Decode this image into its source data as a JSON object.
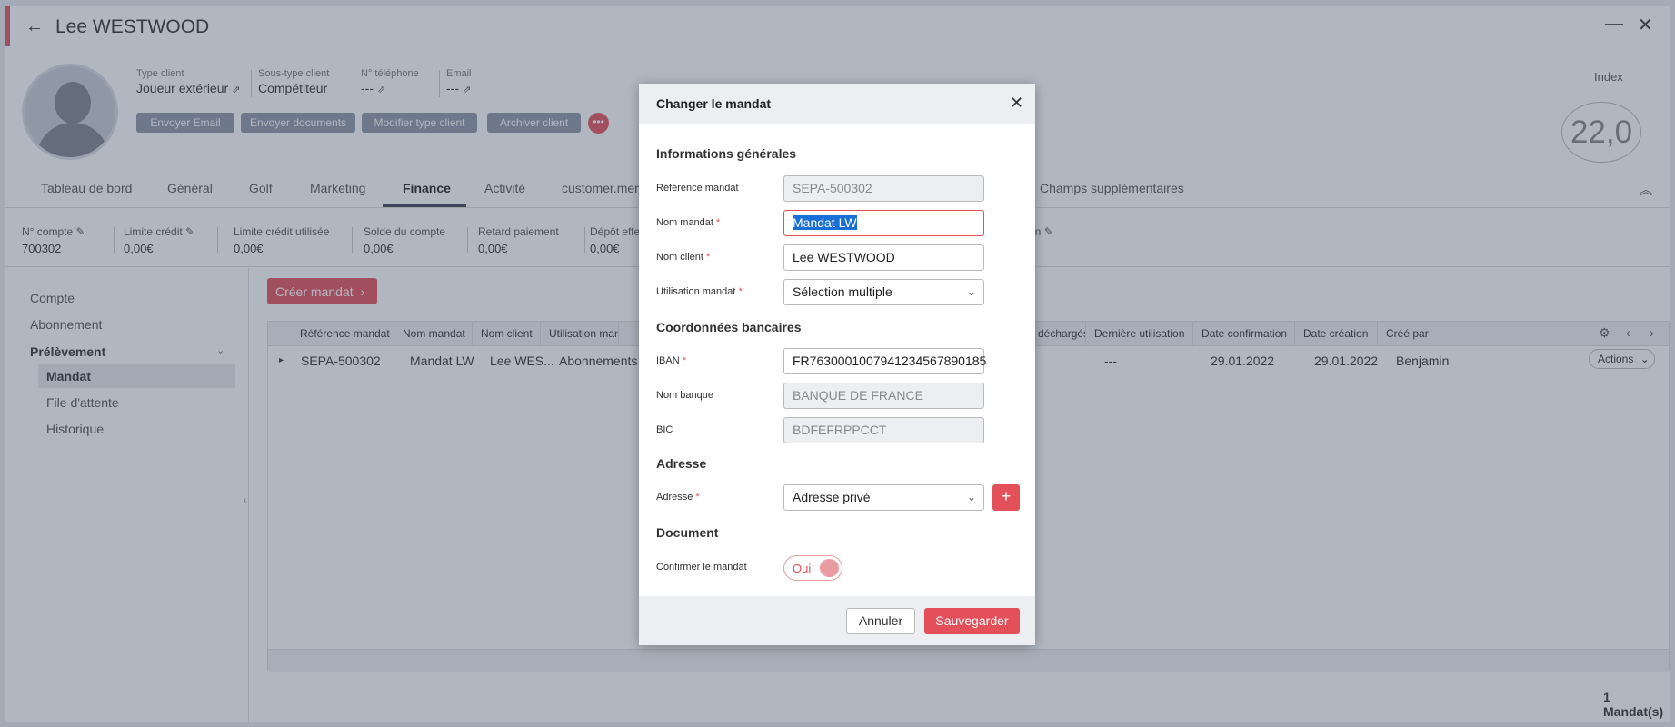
{
  "header": {
    "client_name": "Lee WESTWOOD",
    "back_icon": "←",
    "minimize_icon": "—",
    "close_icon": "✕",
    "index_label": "Index",
    "index_value": "22,0"
  },
  "client_info": [
    {
      "label": "Type client",
      "value": "Joueur extérieur",
      "ext": "⇗"
    },
    {
      "label": "Sous-type client",
      "value": "Compétiteur",
      "ext": ""
    },
    {
      "label": "N° téléphone",
      "value": "---",
      "ext": "⇗"
    },
    {
      "label": "Email",
      "value": "---",
      "ext": "⇗"
    }
  ],
  "actions": [
    "Envoyer Email",
    "Envoyer documents",
    "Modifier type client",
    "Archiver client"
  ],
  "more_icon": "•••",
  "tabs": [
    "Tableau de bord",
    "Général",
    "Golf",
    "Marketing",
    "Finance",
    "Activité",
    "customer.menu",
    "Champs supplémentaires"
  ],
  "collapse_icon": "︽",
  "stats": [
    {
      "label": "N° compte",
      "value": "700302",
      "edit": "✎"
    },
    {
      "label": "Limite crédit",
      "value": "0,00€",
      "edit": "✎"
    },
    {
      "label": "Limite crédit utilisée",
      "value": "0,00€",
      "edit": ""
    },
    {
      "label": "Solde du compte",
      "value": "0,00€",
      "edit": ""
    },
    {
      "label": "Retard paiement",
      "value": "0,00€",
      "edit": ""
    },
    {
      "label": "Dépôt effe",
      "value": "0,00€",
      "edit": ""
    },
    {
      "label": "tion",
      "value": "",
      "edit": "✎"
    }
  ],
  "sidebar": {
    "items": [
      "Compte",
      "Abonnement",
      "Prélèvement",
      "Mandat",
      "File d'attente",
      "Historique"
    ],
    "chevron": "⌄",
    "handle": "‹"
  },
  "create_button": {
    "label": "Créer mandat",
    "arrow": "›"
  },
  "table": {
    "columns": [
      "Référence mandat",
      "Nom mandat",
      "Nom client",
      "Utilisation mandat",
      "déchargés",
      "Dernière utilisation",
      "Date confirmation",
      "Date création",
      "Créé par"
    ],
    "row": {
      "expand": "▸",
      "ref": "SEPA-500302",
      "nom": "Mandat LW",
      "client": "Lee WES...",
      "utilisation": "Abonnements ...",
      "derniere": "---",
      "confirmation": "29.01.2022",
      "creation": "29.01.2022",
      "cree_par": "Benjamin",
      "actions": "Actions",
      "actions_caret": "⌄"
    },
    "gear_icon": "⚙",
    "prev_icon": "‹",
    "next_icon": "›"
  },
  "count": "1 Mandat(s)",
  "modal": {
    "title": "Changer le mandat",
    "close_icon": "✕",
    "sections": {
      "general": "Informations générales",
      "bank": "Coordonnées bancaires",
      "address": "Adresse",
      "document": "Document"
    },
    "fields": {
      "ref_label": "Référence mandat",
      "ref_value": "SEPA-500302",
      "nom_label": "Nom mandat",
      "nom_value": "Mandat LW",
      "client_label": "Nom client",
      "client_value": "Lee WESTWOOD",
      "usage_label": "Utilisation mandat",
      "usage_value": "Sélection multiple",
      "iban_label": "IBAN",
      "iban_value": "FR7630001007941234567890185",
      "banque_label": "Nom banque",
      "banque_value": "BANQUE DE FRANCE",
      "bic_label": "BIC",
      "bic_value": "BDFEFRPPCCT",
      "adresse_label": "Adresse",
      "adresse_value": "Adresse privé",
      "confirm_label": "Confirmer le mandat",
      "confirm_value": "Oui"
    },
    "required_mark": "*",
    "caret": "⌄",
    "plus": "+",
    "cancel": "Annuler",
    "save": "Sauvegarder"
  }
}
